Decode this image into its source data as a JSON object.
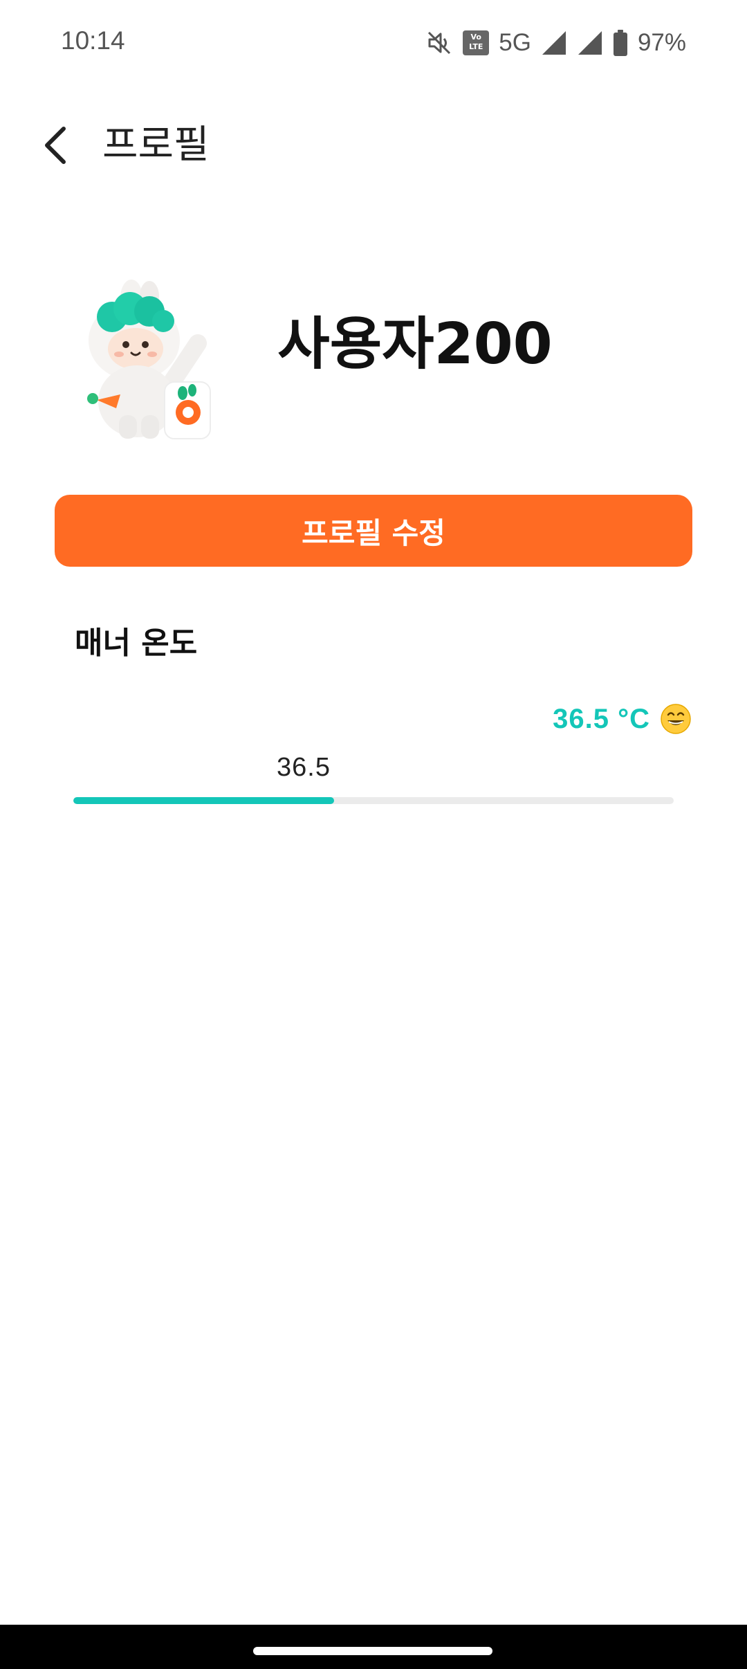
{
  "status_bar": {
    "time": "10:14",
    "network": "5G",
    "battery": "97%",
    "volte_top": "Vo",
    "volte_bottom": "LTE",
    "icons": [
      "mute-icon",
      "volte-icon",
      "signal-icon",
      "signal-icon",
      "battery-icon"
    ]
  },
  "header": {
    "title": "프로필",
    "back_icon": "chevron-left-icon"
  },
  "profile": {
    "user_name": "사용자200",
    "avatar_icon": "rabbit-mascot-avatar"
  },
  "edit_button": {
    "label": "프로필 수정"
  },
  "manner": {
    "title": "매너 온도",
    "readout": "36.5 °C",
    "emoji": "grinning-face-icon",
    "bar_label": "36.5",
    "fill_fraction": 0.434
  },
  "colors": {
    "accent_orange": "#FF6B23",
    "temperature_teal": "#14C6B8",
    "bar_track": "#EBEBEB"
  }
}
